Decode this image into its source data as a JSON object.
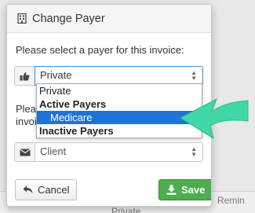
{
  "background": {
    "footer_fragment_1": "Remin",
    "footer_fragment_2": "Private"
  },
  "modal": {
    "title": "Change Payer",
    "title_icon": "building-icon",
    "prompt": "Please select a payer for this invoice:",
    "payer_select": {
      "icon": "thumbs-up-icon",
      "value": "Private"
    },
    "partial_label_1": "Pleas",
    "partial_label_2": "invoic",
    "contact_select": {
      "icon": "envelope-icon",
      "value": "Client"
    },
    "cancel_label": "Cancel",
    "cancel_icon": "reply-arrow-icon",
    "save_label": "Save",
    "save_icon": "download-save-icon"
  },
  "dropdown": {
    "options": [
      {
        "type": "option",
        "label": "Private"
      },
      {
        "type": "group",
        "label": "Active Payers"
      },
      {
        "type": "option",
        "label": "Medicare",
        "selected": true
      },
      {
        "type": "group",
        "label": "Inactive Payers"
      }
    ]
  },
  "colors": {
    "select_focus": "#3a8fd9",
    "option_highlight": "#1e73d9",
    "save_button": "#4cae4c",
    "pointer_arrow": "#3fd6a8"
  }
}
